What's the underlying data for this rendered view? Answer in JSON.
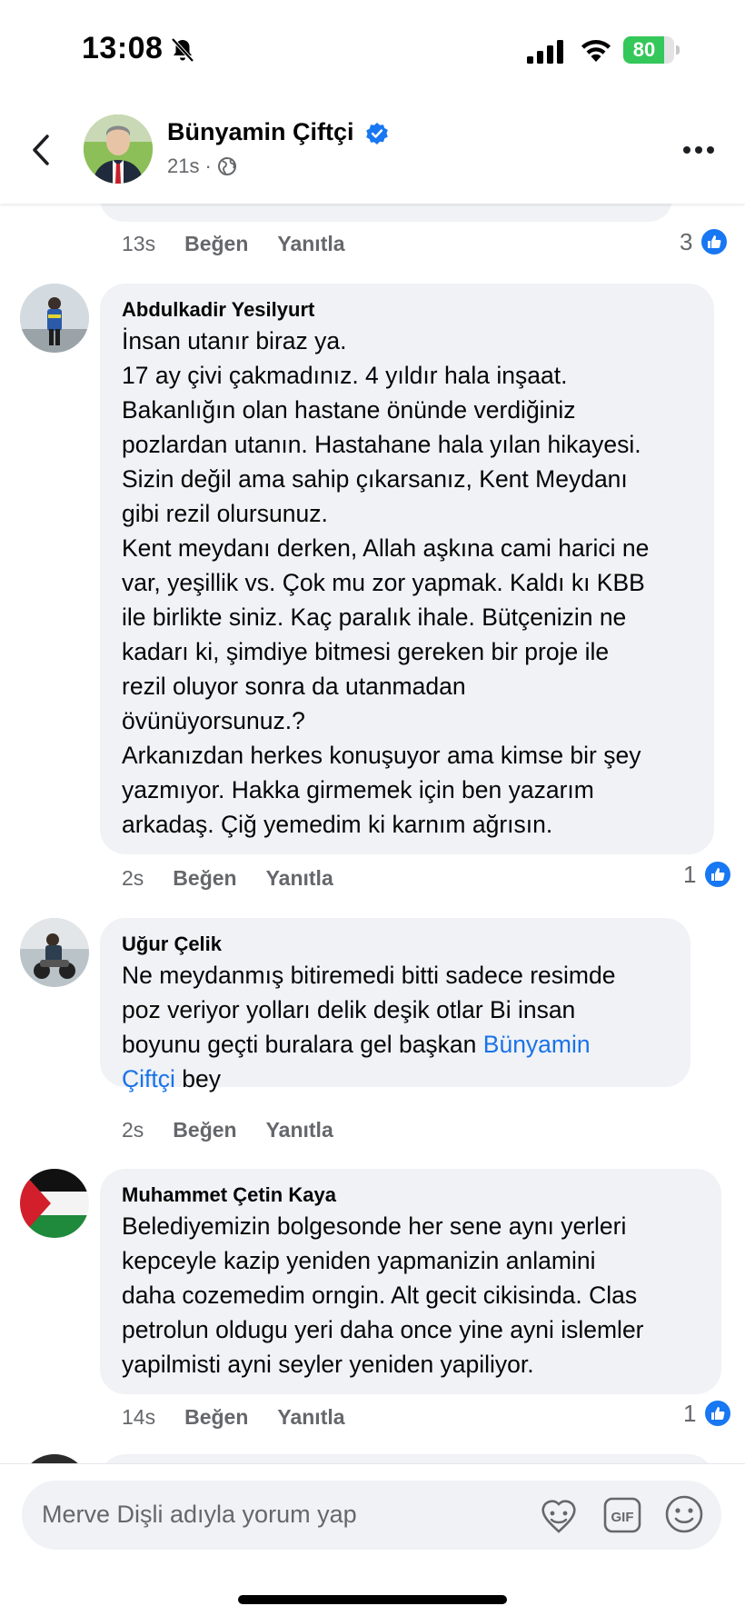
{
  "status_bar": {
    "time": "13:08",
    "battery_percent": 80,
    "battery_label": "80"
  },
  "header": {
    "name": "Bünyamin Çiftçi",
    "time": "21s",
    "separator": "·",
    "verified": true
  },
  "previous_comment": {
    "time": "13s",
    "like_label": "Beğen",
    "reply_label": "Yanıtla",
    "reaction_count": "3"
  },
  "comments": [
    {
      "author": "Abdulkadir Yesilyurt",
      "text": "İnsan utanır biraz ya.\n17 ay çivi çakmadınız. 4 yıldır hala inşaat.\nBakanlığın olan hastane önünde verdiğiniz\npozlardan utanın. Hastahane hala yılan hikayesi.\nSizin değil ama sahip çıkarsanız, Kent Meydanı\ngibi rezil olursunuz.\nKent meydanı derken, Allah aşkına cami harici ne\nvar, yeşillik vs. Çok mu zor yapmak. Kaldı kı KBB\nile birlikte siniz. Kaç paralık ihale. Bütçenizin ne\nkadarı ki, şimdiye bitmesi gereken bir proje ile\nrezil oluyor sonra da utanmadan\növünüyorsunuz.?\nArkanızdan herkes konuşuyor ama kimse bir şey\nyazmıyor. Hakka girmemek için ben yazarım\narkadaş. Çiğ yemedim ki karnım ağrısın.",
      "time": "2s",
      "like_label": "Beğen",
      "reply_label": "Yanıtla",
      "reaction_count": "1"
    },
    {
      "author": "Uğur Çelik",
      "text": "Ne meydanmış bitiremedi bitti sadece resimde\npoz veriyor yolları delik deşik otlar Bi insan\nboyunu geçti buralara gel başkan ",
      "mention": "Bünyamin\nÇiftçi",
      "text_after": "  bey",
      "time": "2s",
      "like_label": "Beğen",
      "reply_label": "Yanıtla",
      "reaction_count": ""
    },
    {
      "author": "Muhammet Çetin Kaya",
      "text": "Belediyemizin bolgesonde her sene aynı yerleri\nkepceyle kazip yeniden yapmanizin anlamini\ndaha cozemedim orngin.  Alt gecit cikisinda. Clas\npetrolun oldugu yeri daha once yine ayni islemler\nyapilmisti ayni seyler yeniden yapiliyor.",
      "time": "14s",
      "like_label": "Beğen",
      "reply_label": "Yanıtla",
      "reaction_count": "1"
    }
  ],
  "composer": {
    "placeholder": "Merve Dişli adıyla yorum yap"
  },
  "colors": {
    "accent": "#1877f2",
    "mention": "#1a73e8",
    "bubble": "#f0f2f5",
    "secondary_text": "#65676b"
  },
  "icons": [
    "back-chevron-icon",
    "verified-badge-icon",
    "globe-icon",
    "more-icon",
    "like-icon",
    "sticker-icon",
    "gif-icon",
    "emoji-icon",
    "bell-off-icon",
    "signal-icon",
    "wifi-icon",
    "battery-icon"
  ]
}
